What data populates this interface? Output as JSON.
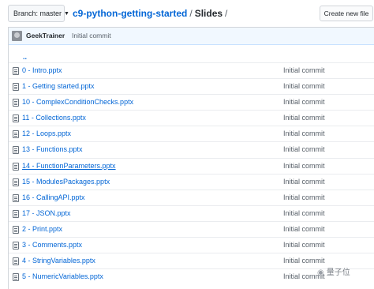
{
  "header": {
    "branch_label": "Branch: master",
    "repo_name": "c9-python-getting-started",
    "separator": "/",
    "current_dir": "Slides",
    "new_file_label": "Create new file"
  },
  "last_commit": {
    "author": "GeekTrainer",
    "message": "Initial commit"
  },
  "parent_link": "..",
  "files": [
    {
      "name": "0 - Intro.pptx",
      "commit": "Initial commit"
    },
    {
      "name": "1 - Getting started.pptx",
      "commit": "Initial commit"
    },
    {
      "name": "10 - ComplexConditionChecks.pptx",
      "commit": "Initial commit"
    },
    {
      "name": "11 - Collections.pptx",
      "commit": "Initial commit"
    },
    {
      "name": "12 - Loops.pptx",
      "commit": "Initial commit"
    },
    {
      "name": "13 - Functions.pptx",
      "commit": "Initial commit"
    },
    {
      "name": "14 - FunctionParameters.pptx",
      "commit": "Initial commit"
    },
    {
      "name": "15 - ModulesPackages.pptx",
      "commit": "Initial commit"
    },
    {
      "name": "16 - CallingAPI.pptx",
      "commit": "Initial commit"
    },
    {
      "name": "17 - JSON.pptx",
      "commit": "Initial commit"
    },
    {
      "name": "2 - Print.pptx",
      "commit": "Initial commit"
    },
    {
      "name": "3 - Comments.pptx",
      "commit": "Initial commit"
    },
    {
      "name": "4 - StringVariables.pptx",
      "commit": "Initial commit"
    },
    {
      "name": "5 - NumericVariables.pptx",
      "commit": "Initial commit"
    }
  ],
  "watermark": {
    "text": "量子位",
    "icon": "wechat-icon"
  }
}
